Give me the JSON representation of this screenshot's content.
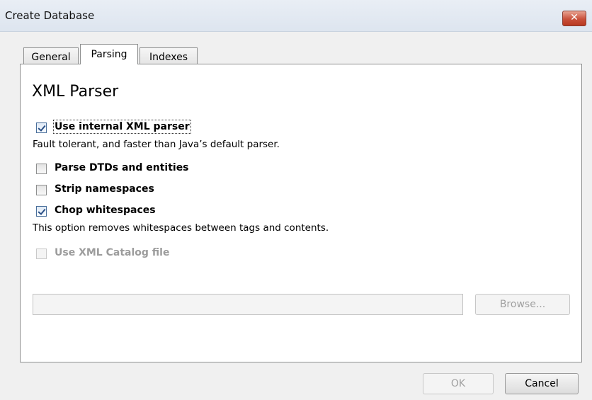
{
  "window": {
    "title": "Create Database",
    "close_icon": "close-icon"
  },
  "tabs": [
    {
      "label": "General",
      "active": false
    },
    {
      "label": "Parsing",
      "active": true
    },
    {
      "label": "Indexes",
      "active": false
    }
  ],
  "parser": {
    "heading": "XML Parser",
    "use_internal": {
      "label": "Use internal XML parser",
      "checked": true
    },
    "use_internal_desc": "Fault tolerant, and faster than Java’s default parser.",
    "parse_dtds": {
      "label": "Parse DTDs and entities",
      "checked": false
    },
    "strip_ns": {
      "label": "Strip namespaces",
      "checked": false
    },
    "chop_ws": {
      "label": "Chop whitespaces",
      "checked": true
    },
    "chop_ws_desc": "This option removes whitespaces between tags and contents.",
    "catalog": {
      "label": "Use XML Catalog file",
      "checked": false,
      "enabled": false
    },
    "catalog_path": "",
    "browse_label": "Browse..."
  },
  "footer": {
    "ok_label": "OK",
    "cancel_label": "Cancel"
  }
}
